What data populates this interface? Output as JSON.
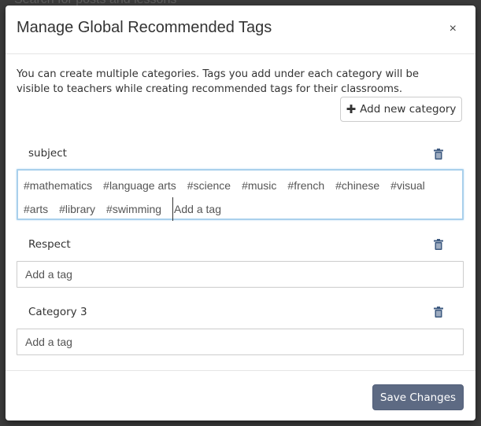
{
  "backdrop": {
    "search_text": "Search for posts and lessons"
  },
  "modal": {
    "title": "Manage Global Recommended Tags",
    "close_label": "×",
    "intro": "You can create multiple categories. Tags you add under each category will be visible to teachers while creating recommended tags for their classrooms.",
    "add_category_label": "Add new category",
    "save_label": "Save Changes"
  },
  "categories": [
    {
      "name": "subject",
      "tags": [
        "#mathematics",
        "#language arts",
        "#science",
        "#music",
        "#french",
        "#chinese",
        "#visual",
        "#arts",
        "#library",
        "#swimming"
      ],
      "input_placeholder": "Add a tag"
    },
    {
      "name": "Respect",
      "tags": [],
      "input_placeholder": "Add a tag"
    },
    {
      "name": "Category 3",
      "tags": [],
      "input_placeholder": "Add a tag"
    }
  ],
  "icons": {
    "trash": "trash-icon",
    "plus": "plus-icon",
    "close": "close-icon"
  },
  "colors": {
    "save_button": "#5d6a83",
    "focus_border": "#a9d0ec",
    "trash": "#3d5a80"
  }
}
